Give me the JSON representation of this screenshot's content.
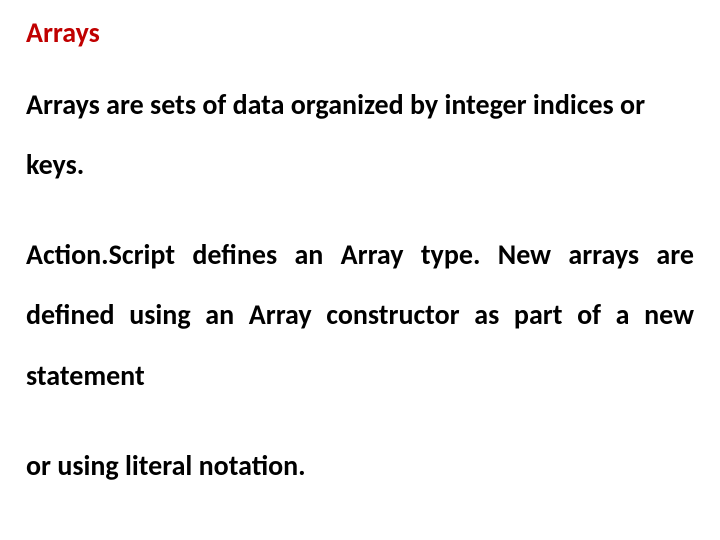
{
  "slide": {
    "title": "Arrays",
    "p1": "Arrays are sets of data organized by integer indices or keys.",
    "p2": "Action.Script defines an Array type. New arrays are defined using an Array constructor as part of a new statement",
    "p3": "or using literal notation."
  }
}
